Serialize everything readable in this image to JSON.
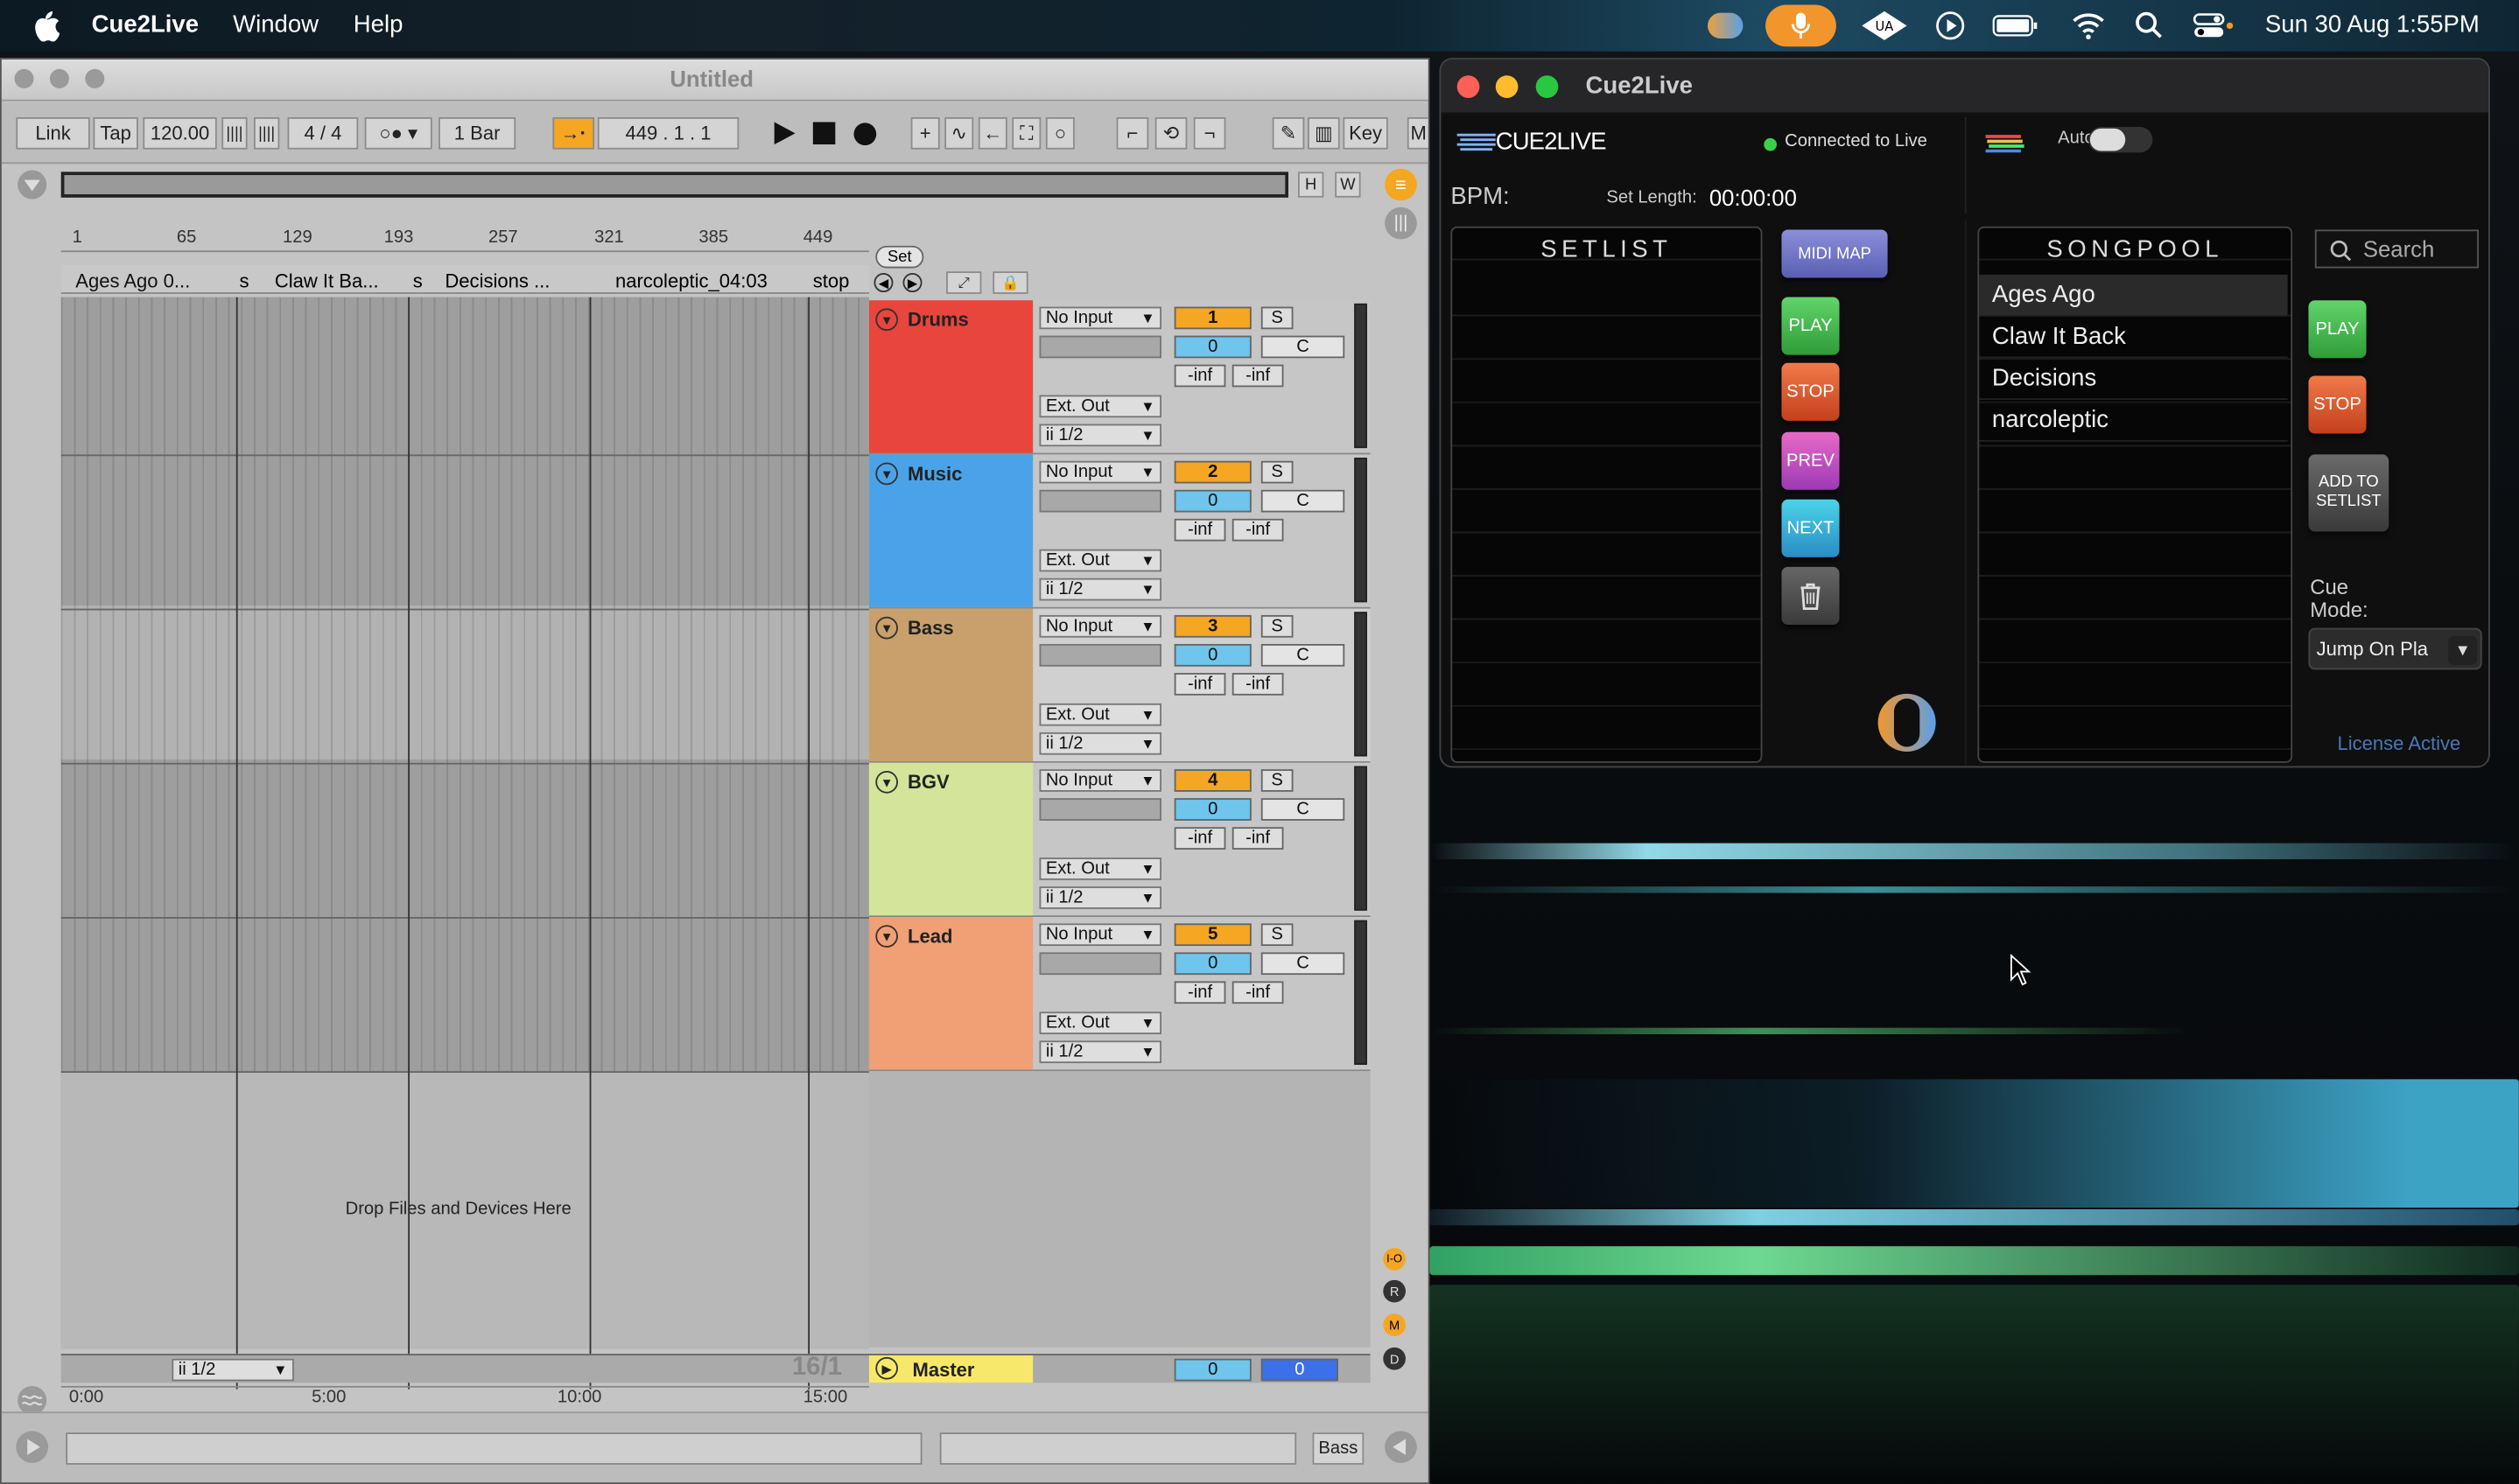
{
  "menubar": {
    "app_name": "Cue2Live",
    "menus": [
      "Window",
      "Help"
    ],
    "datetime": "Sun 30 Aug  1:55PM"
  },
  "live": {
    "window_title": "Untitled",
    "transport": {
      "link": "Link",
      "tap": "Tap",
      "tempo": "120.00",
      "signature": "4 / 4",
      "quantize": "1 Bar",
      "position": "449 .  1 .  1",
      "key": "Key",
      "h": "H",
      "w": "W"
    },
    "ruler": [
      "1",
      "65",
      "129",
      "193",
      "257",
      "321",
      "385",
      "449"
    ],
    "set_label": "Set",
    "locators": [
      "Ages Ago    0...",
      "s",
      "Claw It Ba...",
      "s",
      "Decisions    ...",
      "narcoleptic_04:03",
      "stop"
    ],
    "tracks": [
      {
        "name": "Drums",
        "color": "#e8453c",
        "input": "No Input",
        "output": "Ext. Out",
        "channel": "ii 1/2",
        "number": "1",
        "solo": "S",
        "volume": "0",
        "pan": "C",
        "peak1": "-inf",
        "peak2": "-inf"
      },
      {
        "name": "Music",
        "color": "#4aa3e8",
        "input": "No Input",
        "output": "Ext. Out",
        "channel": "ii 1/2",
        "number": "2",
        "solo": "S",
        "volume": "0",
        "pan": "C",
        "peak1": "-inf",
        "peak2": "-inf"
      },
      {
        "name": "Bass",
        "color": "#c9a06b",
        "input": "No Input",
        "output": "Ext. Out",
        "channel": "ii 1/2",
        "number": "3",
        "solo": "S",
        "volume": "0",
        "pan": "C",
        "peak1": "-inf",
        "peak2": "-inf"
      },
      {
        "name": "BGV",
        "color": "#d4e49a",
        "input": "No Input",
        "output": "Ext. Out",
        "channel": "ii 1/2",
        "number": "4",
        "solo": "S",
        "volume": "0",
        "pan": "C",
        "peak1": "-inf",
        "peak2": "-inf"
      },
      {
        "name": "Lead",
        "color": "#f0a074",
        "input": "No Input",
        "output": "Ext. Out",
        "channel": "ii 1/2",
        "number": "5",
        "solo": "S",
        "volume": "0",
        "pan": "C",
        "peak1": "-inf",
        "peak2": "-inf"
      }
    ],
    "drop_text": "Drop Files and Devices Here",
    "master": {
      "name": "Master",
      "channel": "ii 1/2",
      "volume": "0",
      "cue": "0"
    },
    "zoom_label": "16/1",
    "time_ruler": [
      "0:00",
      "5:00",
      "10:00",
      "15:00"
    ],
    "side_letters": [
      "I-O",
      "R",
      "M",
      "D"
    ],
    "status_track": "Bass"
  },
  "c2l": {
    "window_title": "Cue2Live",
    "logo": "CUE2LIVE",
    "status": "Connected to Live",
    "status_color": "#3cd04a",
    "auto_label": "Auto",
    "bpm_label": "BPM:",
    "set_length_label": "Set Length:",
    "set_length": "00:00:00",
    "setlist_title": "SETLIST",
    "songpool_title": "SONGPOOL",
    "search_placeholder": "Search",
    "midi_map": "MIDI MAP",
    "play": "PLAY",
    "stop": "STOP",
    "prev": "PREV",
    "next": "NEXT",
    "add_to_setlist": "ADD TO SETLIST",
    "cue_mode_label": "Cue Mode:",
    "cue_mode_value": "Jump On Pla",
    "license": "License Active",
    "songs": [
      "Ages Ago",
      "Claw It Back",
      "Decisions",
      "narcoleptic"
    ]
  }
}
